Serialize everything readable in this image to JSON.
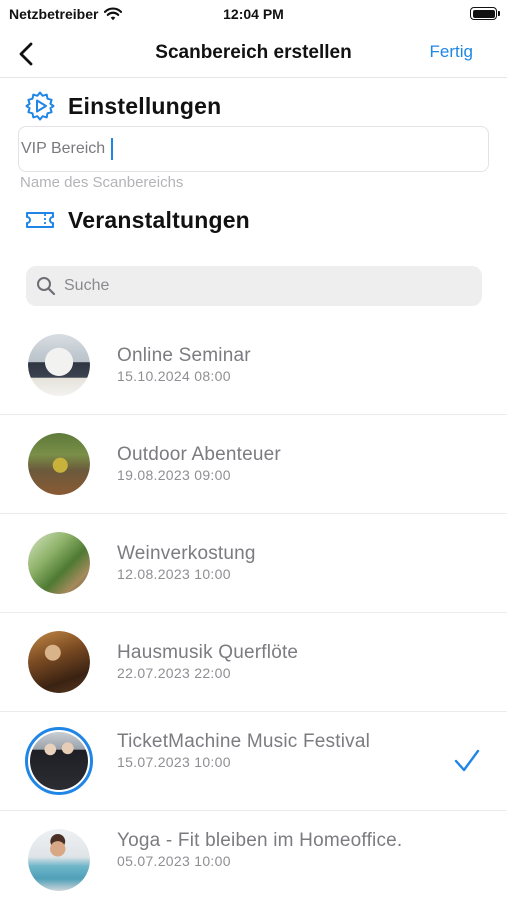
{
  "status_bar": {
    "carrier": "Netzbetreiber",
    "time": "12:04 PM"
  },
  "nav": {
    "title": "Scanbereich erstellen",
    "done_label": "Fertig"
  },
  "settings": {
    "heading": "Einstellungen",
    "name_value": "VIP Bereich",
    "name_caption": "Name des Scanbereichs"
  },
  "events": {
    "heading": "Veranstaltungen",
    "search_placeholder": "Suche",
    "items": [
      {
        "title": "Online Seminar",
        "date": "15.10.2024 08:00",
        "selected": false
      },
      {
        "title": "Outdoor Abenteuer",
        "date": "19.08.2023 09:00",
        "selected": false
      },
      {
        "title": "Weinverkostung",
        "date": "12.08.2023 10:00",
        "selected": false
      },
      {
        "title": "Hausmusik Querflöte",
        "date": "22.07.2023 22:00",
        "selected": false
      },
      {
        "title": "TicketMachine Music Festival",
        "date": "15.07.2023 10:00",
        "selected": true
      },
      {
        "title": "Yoga - Fit bleiben im Homeoffice.",
        "date": "05.07.2023 10:00",
        "selected": false
      }
    ]
  },
  "colors": {
    "accent": "#1f86e6",
    "title_text": "#111111",
    "muted_text": "#7b7b80"
  }
}
